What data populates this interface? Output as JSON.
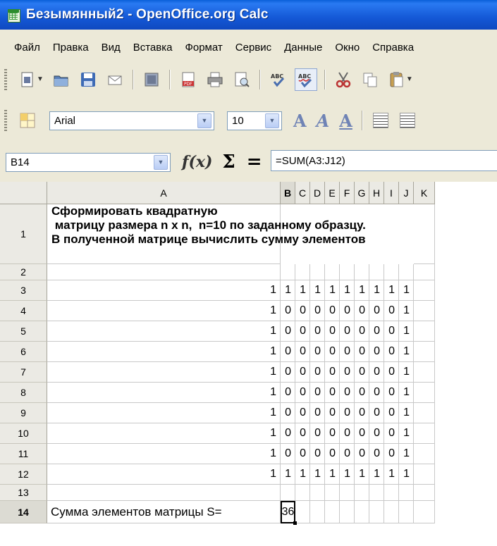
{
  "window": {
    "title": "Безымянный2 - OpenOffice.org Calc"
  },
  "menu": [
    "Файл",
    "Правка",
    "Вид",
    "Вставка",
    "Формат",
    "Сервис",
    "Данные",
    "Окно",
    "Справка"
  ],
  "toolbar": {
    "font_name": "Arial",
    "font_size": "10",
    "icons": [
      "new-icon",
      "open-icon",
      "save-icon",
      "email-icon",
      "edit-file-icon",
      "export-pdf-icon",
      "print-icon",
      "page-preview-icon",
      "spellcheck-icon",
      "autospellcheck-icon",
      "cut-icon",
      "copy-icon",
      "paste-icon"
    ]
  },
  "formula_bar": {
    "cell_ref": "B14",
    "fx": "f(x)",
    "sigma": "Σ",
    "equals": "=",
    "formula": "=SUM(A3:J12)"
  },
  "sheet": {
    "columns": [
      "A",
      "B",
      "C",
      "D",
      "E",
      "F",
      "G",
      "H",
      "I",
      "J",
      "K"
    ],
    "selected_column": "B",
    "rows": [
      "1",
      "2",
      "3",
      "4",
      "5",
      "6",
      "7",
      "8",
      "9",
      "10",
      "11",
      "12",
      "13",
      "14"
    ],
    "selected_row": "14",
    "task_line1": "Сформировать квадратную",
    "task_line2": " матрицу размера n x n,  n=10 по заданному образцу.",
    "task_line3": "В полученной матрице вычислить сумму элементов",
    "matrix": [
      [
        1,
        1,
        1,
        1,
        1,
        1,
        1,
        1,
        1,
        1
      ],
      [
        1,
        0,
        0,
        0,
        0,
        0,
        0,
        0,
        0,
        1
      ],
      [
        1,
        0,
        0,
        0,
        0,
        0,
        0,
        0,
        0,
        1
      ],
      [
        1,
        0,
        0,
        0,
        0,
        0,
        0,
        0,
        0,
        1
      ],
      [
        1,
        0,
        0,
        0,
        0,
        0,
        0,
        0,
        0,
        1
      ],
      [
        1,
        0,
        0,
        0,
        0,
        0,
        0,
        0,
        0,
        1
      ],
      [
        1,
        0,
        0,
        0,
        0,
        0,
        0,
        0,
        0,
        1
      ],
      [
        1,
        0,
        0,
        0,
        0,
        0,
        0,
        0,
        0,
        1
      ],
      [
        1,
        0,
        0,
        0,
        0,
        0,
        0,
        0,
        0,
        1
      ],
      [
        1,
        1,
        1,
        1,
        1,
        1,
        1,
        1,
        1,
        1
      ]
    ],
    "sum_label": "Сумма элементов матрицы S=",
    "sum_value": "36"
  }
}
